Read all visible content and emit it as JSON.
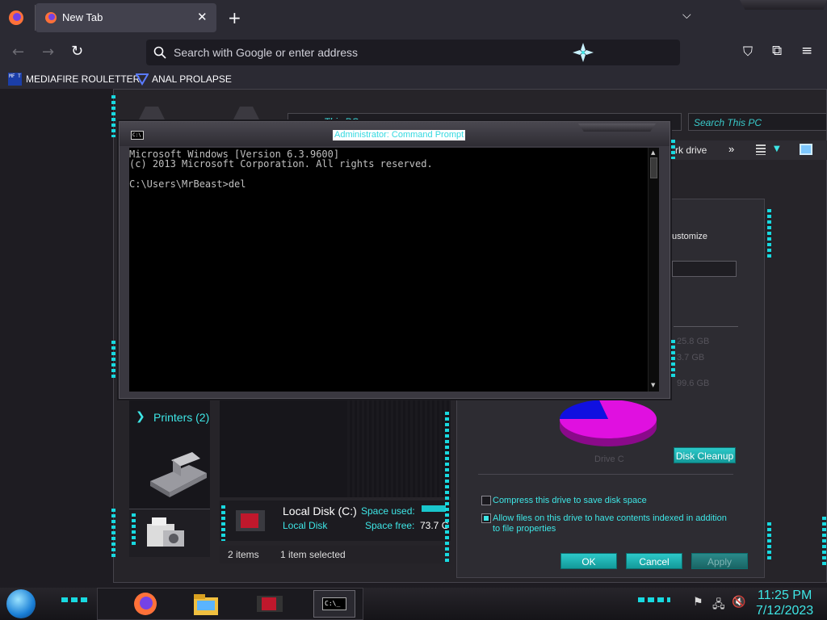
{
  "browser": {
    "tab_title": "New Tab",
    "url_placeholder": "Search with Google or enter address",
    "bookmarks": [
      "MEDIAFIRE ROULETTER",
      "ANAL PROLAPSE"
    ],
    "bookmark_icon_text": "MF T"
  },
  "explorer": {
    "address": "This PC",
    "search_placeholder": "Search This PC",
    "toolbar_item": "rk drive",
    "printers_label": "Printers (2)",
    "disk_name": "Local Disk (C:)",
    "disk_type": "Local Disk",
    "space_used_label": "Space used:",
    "space_free_label": "Space free:",
    "space_free_value": "73.7 G",
    "status_items": "2 items",
    "status_selected": "1 item selected"
  },
  "cmd": {
    "title": "Administrator: Command Prompt",
    "icon_text": "C:\\",
    "lines": [
      "Microsoft Windows [Version 6.3.9600]",
      "(c) 2013 Microsoft Corporation. All rights reserved.",
      "",
      "C:\\Users\\MrBeast>del"
    ]
  },
  "properties": {
    "customize_tab": "ustomize",
    "size_used": "25.8 GB",
    "size_free": "3.7 GB",
    "size_total": "99.6 GB",
    "drive_label": "Drive C",
    "disk_cleanup": "Disk Cleanup",
    "compress_label": "Compress this drive to save disk space",
    "index_label": "Allow files on this drive to have contents indexed in addition to file properties",
    "compress_checked": false,
    "index_checked": true,
    "ok": "OK",
    "cancel": "Cancel",
    "apply": "Apply",
    "pie": {
      "used_fraction": 0.22,
      "used_color": "#1010e0",
      "free_color": "#e010e0"
    }
  },
  "taskbar": {
    "time": "11:25 PM",
    "date": "7/12/2023",
    "cmd_icon_text": "C:\\_"
  },
  "colors": {
    "accent": "#3ee6e6",
    "browser_bg": "#2b2a33"
  }
}
